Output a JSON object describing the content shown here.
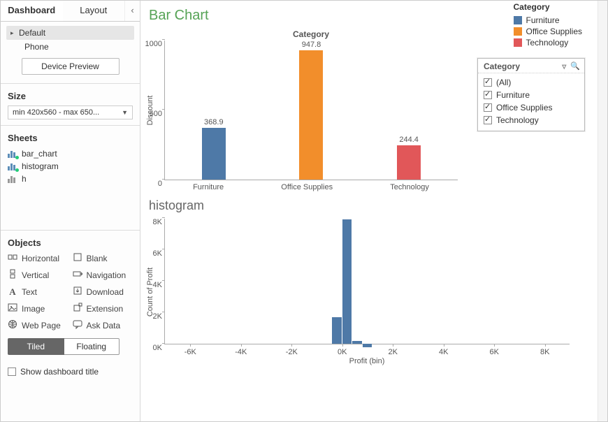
{
  "tabs": {
    "dashboard": "Dashboard",
    "layout": "Layout"
  },
  "devices": {
    "default": "Default",
    "phone": "Phone",
    "preview_btn": "Device Preview"
  },
  "size": {
    "heading": "Size",
    "value": "min 420x560 - max 650..."
  },
  "sheets": {
    "heading": "Sheets",
    "items": [
      "bar_chart",
      "histogram",
      "h"
    ]
  },
  "objects": {
    "heading": "Objects",
    "items": [
      {
        "label": "Horizontal",
        "icon": "horizontal"
      },
      {
        "label": "Blank",
        "icon": "blank"
      },
      {
        "label": "Vertical",
        "icon": "vertical"
      },
      {
        "label": "Navigation",
        "icon": "navigation"
      },
      {
        "label": "Text",
        "icon": "text"
      },
      {
        "label": "Download",
        "icon": "download"
      },
      {
        "label": "Image",
        "icon": "image"
      },
      {
        "label": "Extension",
        "icon": "extension"
      },
      {
        "label": "Web Page",
        "icon": "webpage"
      },
      {
        "label": "Ask Data",
        "icon": "askdata"
      }
    ],
    "tiled": "Tiled",
    "floating": "Floating"
  },
  "show_title": "Show dashboard title",
  "legend": {
    "heading": "Category",
    "items": [
      {
        "label": "Furniture",
        "color": "#4e79a7"
      },
      {
        "label": "Office Supplies",
        "color": "#f28e2b"
      },
      {
        "label": "Technology",
        "color": "#e15759"
      }
    ]
  },
  "filter": {
    "heading": "Category",
    "options": [
      "(All)",
      "Furniture",
      "Office Supplies",
      "Technology"
    ]
  },
  "chart_data": [
    {
      "type": "bar",
      "title": "Bar Chart",
      "axis_title": "Category",
      "ylabel": "Discount",
      "ylim": [
        0,
        1000
      ],
      "yticks": [
        0,
        500,
        1000
      ],
      "categories": [
        "Furniture",
        "Office Supplies",
        "Technology"
      ],
      "values": [
        368.9,
        947.8,
        244.4
      ],
      "colors": [
        "#4e79a7",
        "#f28e2b",
        "#e15759"
      ]
    },
    {
      "type": "histogram",
      "title": "histogram",
      "xlabel": "Profit (bin)",
      "ylabel": "Count of Profit",
      "xlim": [
        -7000,
        9000
      ],
      "xticks": [
        -6000,
        -4000,
        -2000,
        0,
        2000,
        4000,
        6000,
        8000
      ],
      "xtick_labels": [
        "-6K",
        "-4K",
        "-2K",
        "0K",
        "2K",
        "4K",
        "6K",
        "8K"
      ],
      "ylim": [
        0,
        8000
      ],
      "yticks": [
        0,
        2000,
        4000,
        6000,
        8000
      ],
      "ytick_labels": [
        "0K",
        "2K",
        "4K",
        "6K",
        "8K"
      ],
      "bins": [
        {
          "x": -400,
          "count": 1700
        },
        {
          "x": 0,
          "count": 7900
        },
        {
          "x": 400,
          "count": 200
        },
        {
          "x": 800,
          "count": -200
        }
      ],
      "bin_width": 400
    }
  ]
}
